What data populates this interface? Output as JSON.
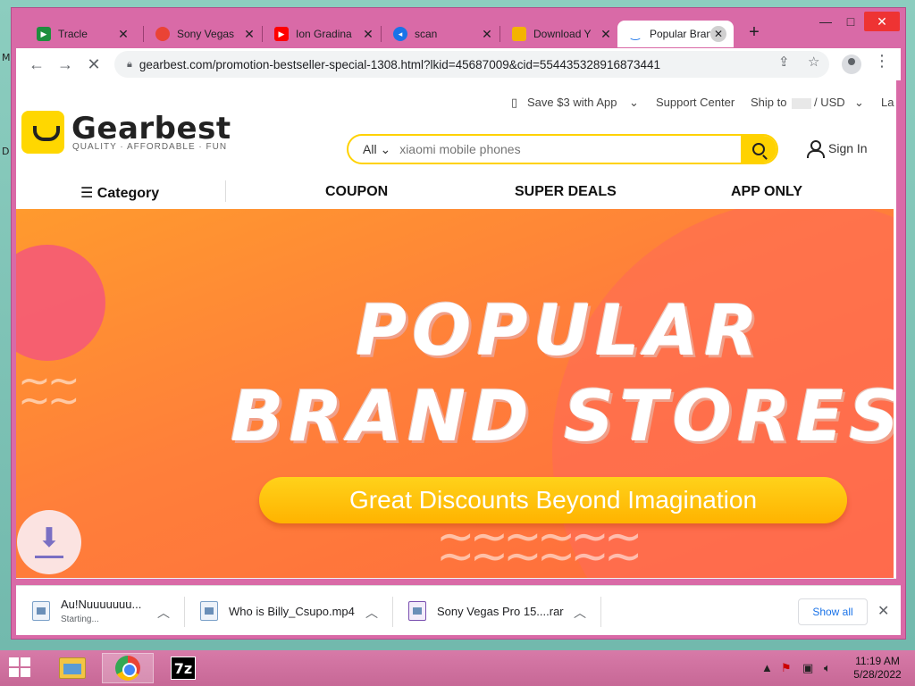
{
  "tabs": [
    {
      "title": "Tracle",
      "favicon_color": "#1e8e3e"
    },
    {
      "title": "Sony Vegas",
      "favicon_color": "#ea4335"
    },
    {
      "title": "Ion Gradina",
      "favicon_color": "#ff0000"
    },
    {
      "title": "scan",
      "favicon_color": "#1a73e8"
    },
    {
      "title": "Download Y",
      "favicon_color": "#f4b400"
    },
    {
      "title": "Popular Bran",
      "favicon_color": "#1a73e8",
      "active": true
    }
  ],
  "browser": {
    "url": "gearbest.com/promotion-bestseller-special-1308.html?lkid=45687009&cid=554435328916873441"
  },
  "site": {
    "topbar": {
      "app_promo": "Save $3 with App",
      "support": "Support Center",
      "ship_to": "Ship to",
      "currency": "/ USD",
      "language": "La"
    },
    "logo": {
      "name": "Gearbest",
      "tagline": "QUALITY · AFFORDABLE · FUN"
    },
    "search": {
      "category": "All",
      "placeholder": "xiaomi mobile phones"
    },
    "signin": "Sign In",
    "nav": {
      "category": "Category",
      "coupon": "COUPON",
      "super_deals": "SUPER DEALS",
      "app_only": "APP ONLY"
    },
    "banner": {
      "line1": "POPULAR",
      "line2": "BRAND STORES",
      "cta": "Great Discounts Beyond Imagination"
    }
  },
  "downloads": {
    "items": [
      {
        "name": "Au!Nuuuuuuu...",
        "status": "Starting..."
      },
      {
        "name": "Who is Billy_Csupo.mp4",
        "status": ""
      },
      {
        "name": "Sony Vegas Pro 15....rar",
        "status": ""
      }
    ],
    "show_all": "Show all"
  },
  "taskbar": {
    "time": "11:19 AM",
    "date": "5/28/2022",
    "apps": [
      "file-explorer",
      "chrome",
      "7-zip"
    ],
    "zip_label": "7z"
  },
  "colors": {
    "window_frame": "#d96aa7",
    "accent_yellow": "#ffd200",
    "banner_orange": "#ff7f3a"
  }
}
